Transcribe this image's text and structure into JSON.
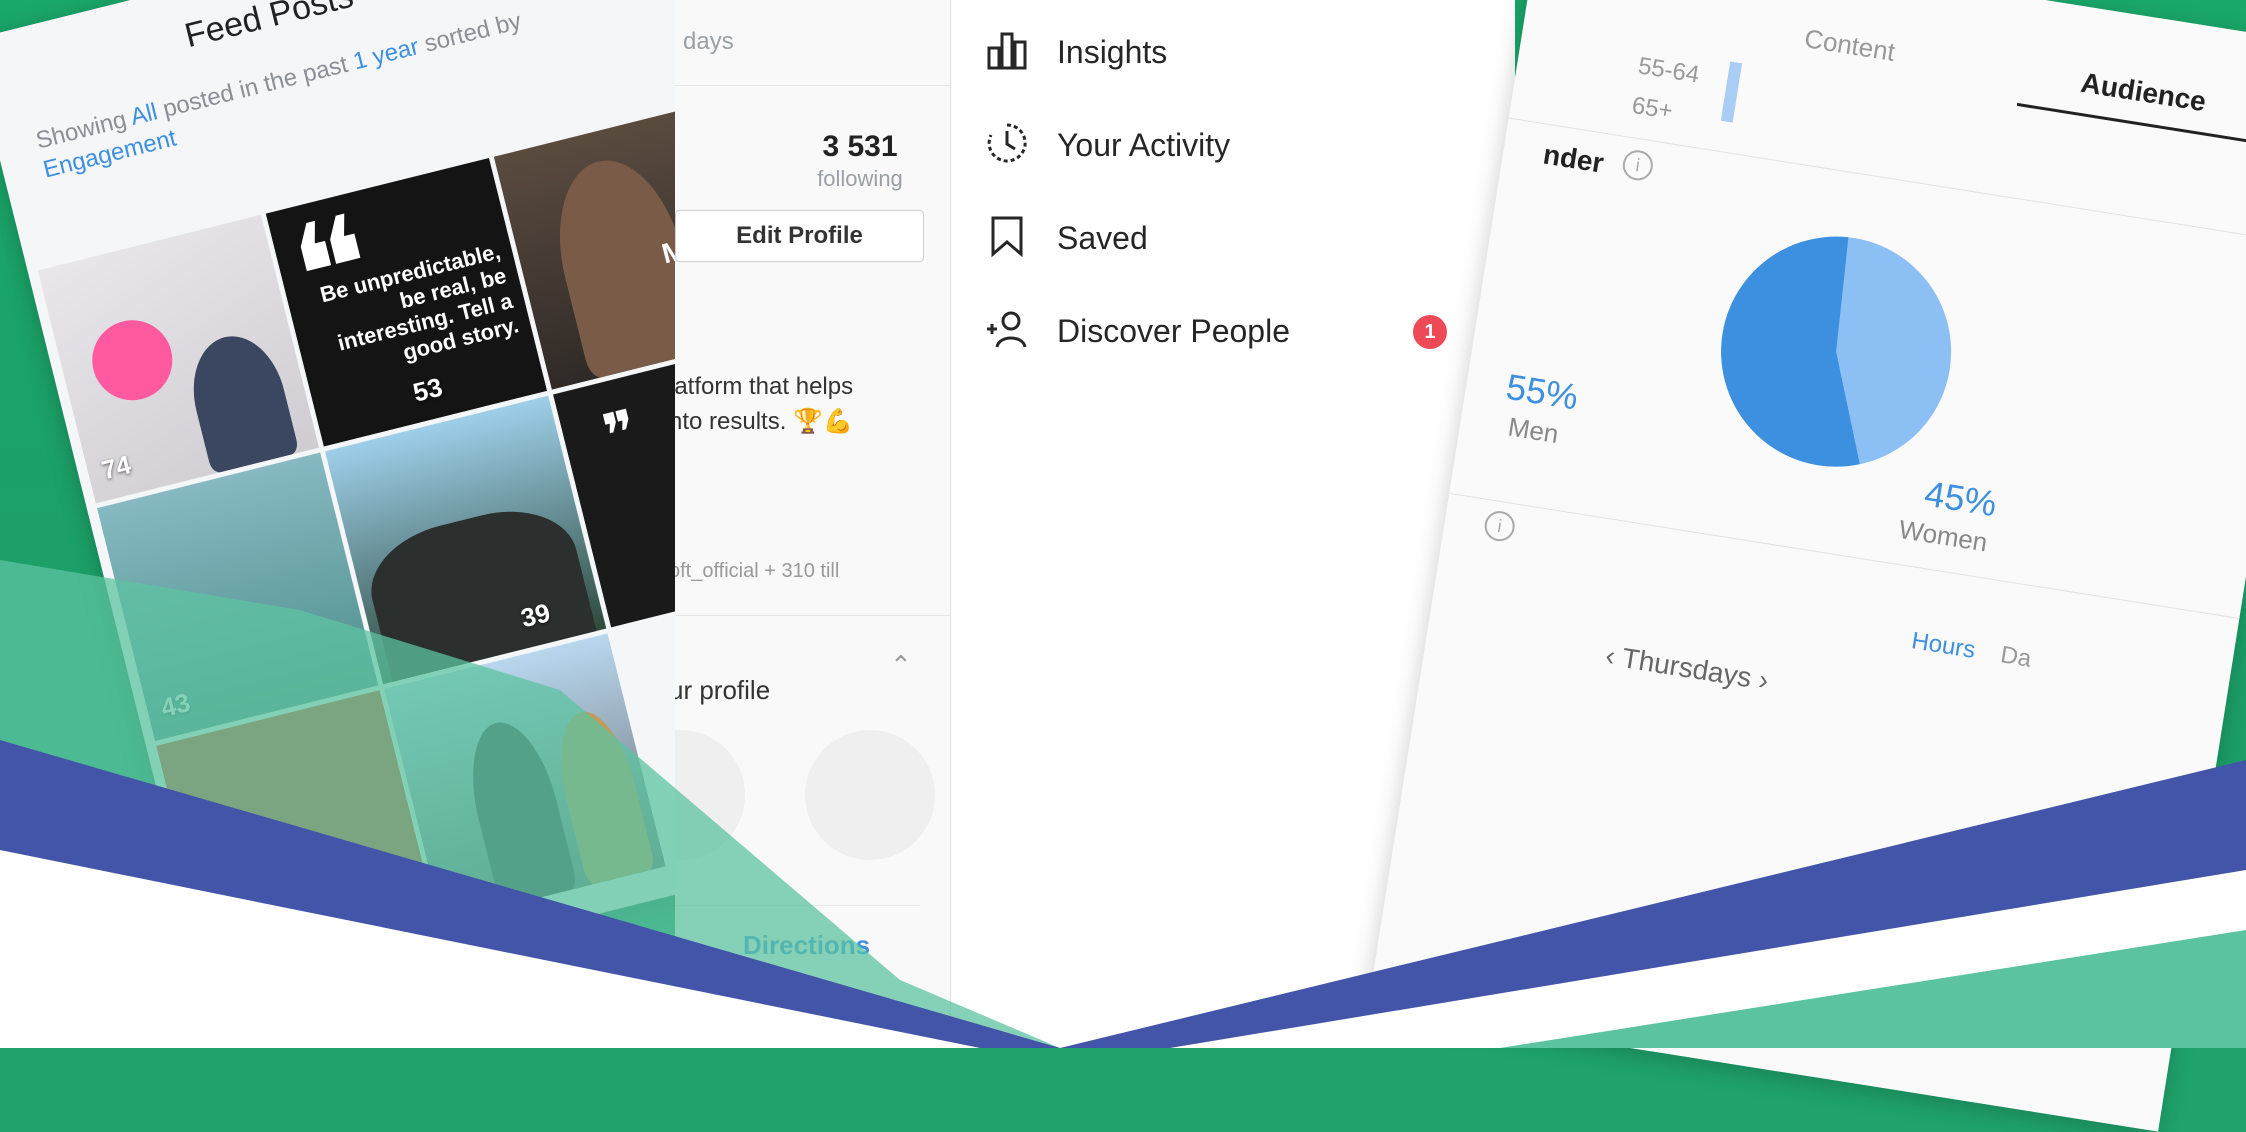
{
  "feed": {
    "title": "Feed Posts",
    "subtitle_prefix": "Showing",
    "filter_all": "All",
    "subtitle_mid": "posted in the past",
    "filter_period": "1 year",
    "subtitle_sort": "sorted by",
    "filter_sort": "Engagement",
    "quote": "Be unpredictable, be real, be interesting. Tell a good story.",
    "watermark": "MORA",
    "counts": [
      "74",
      "53",
      "43",
      "39"
    ]
  },
  "profile": {
    "period": "days",
    "following_count": "3 531",
    "following_label": "following",
    "edit_button": "Edit Profile",
    "bio_line1": "latform that helps",
    "bio_line2": "nto results. 🏆💪",
    "tag_line": "oft_official + 310 till",
    "section": "ur profile",
    "directions": "Directions"
  },
  "menu": {
    "items": [
      {
        "label": "Insights",
        "icon": "insights-icon"
      },
      {
        "label": "Your Activity",
        "icon": "activity-icon"
      },
      {
        "label": "Saved",
        "icon": "bookmark-icon"
      },
      {
        "label": "Discover People",
        "icon": "add-person-icon",
        "badge": "1"
      }
    ]
  },
  "audience": {
    "tab_content": "Content",
    "tab_audience": "Audience",
    "age_ranges": [
      "55-64",
      "65+"
    ],
    "gender_heading": "nder",
    "men_pct": "55%",
    "men_label": "Men",
    "women_pct": "45%",
    "women_label": "Women",
    "hours": "Hours",
    "days": "Da",
    "day_nav": "Thursdays",
    "men_share": 0.55,
    "colors": {
      "men": "#3d8fe0",
      "women": "#8cc0f5"
    }
  },
  "colors": {
    "green": "#1fa36b",
    "navy": "#4355a8",
    "teal": "#5cc3a0"
  }
}
